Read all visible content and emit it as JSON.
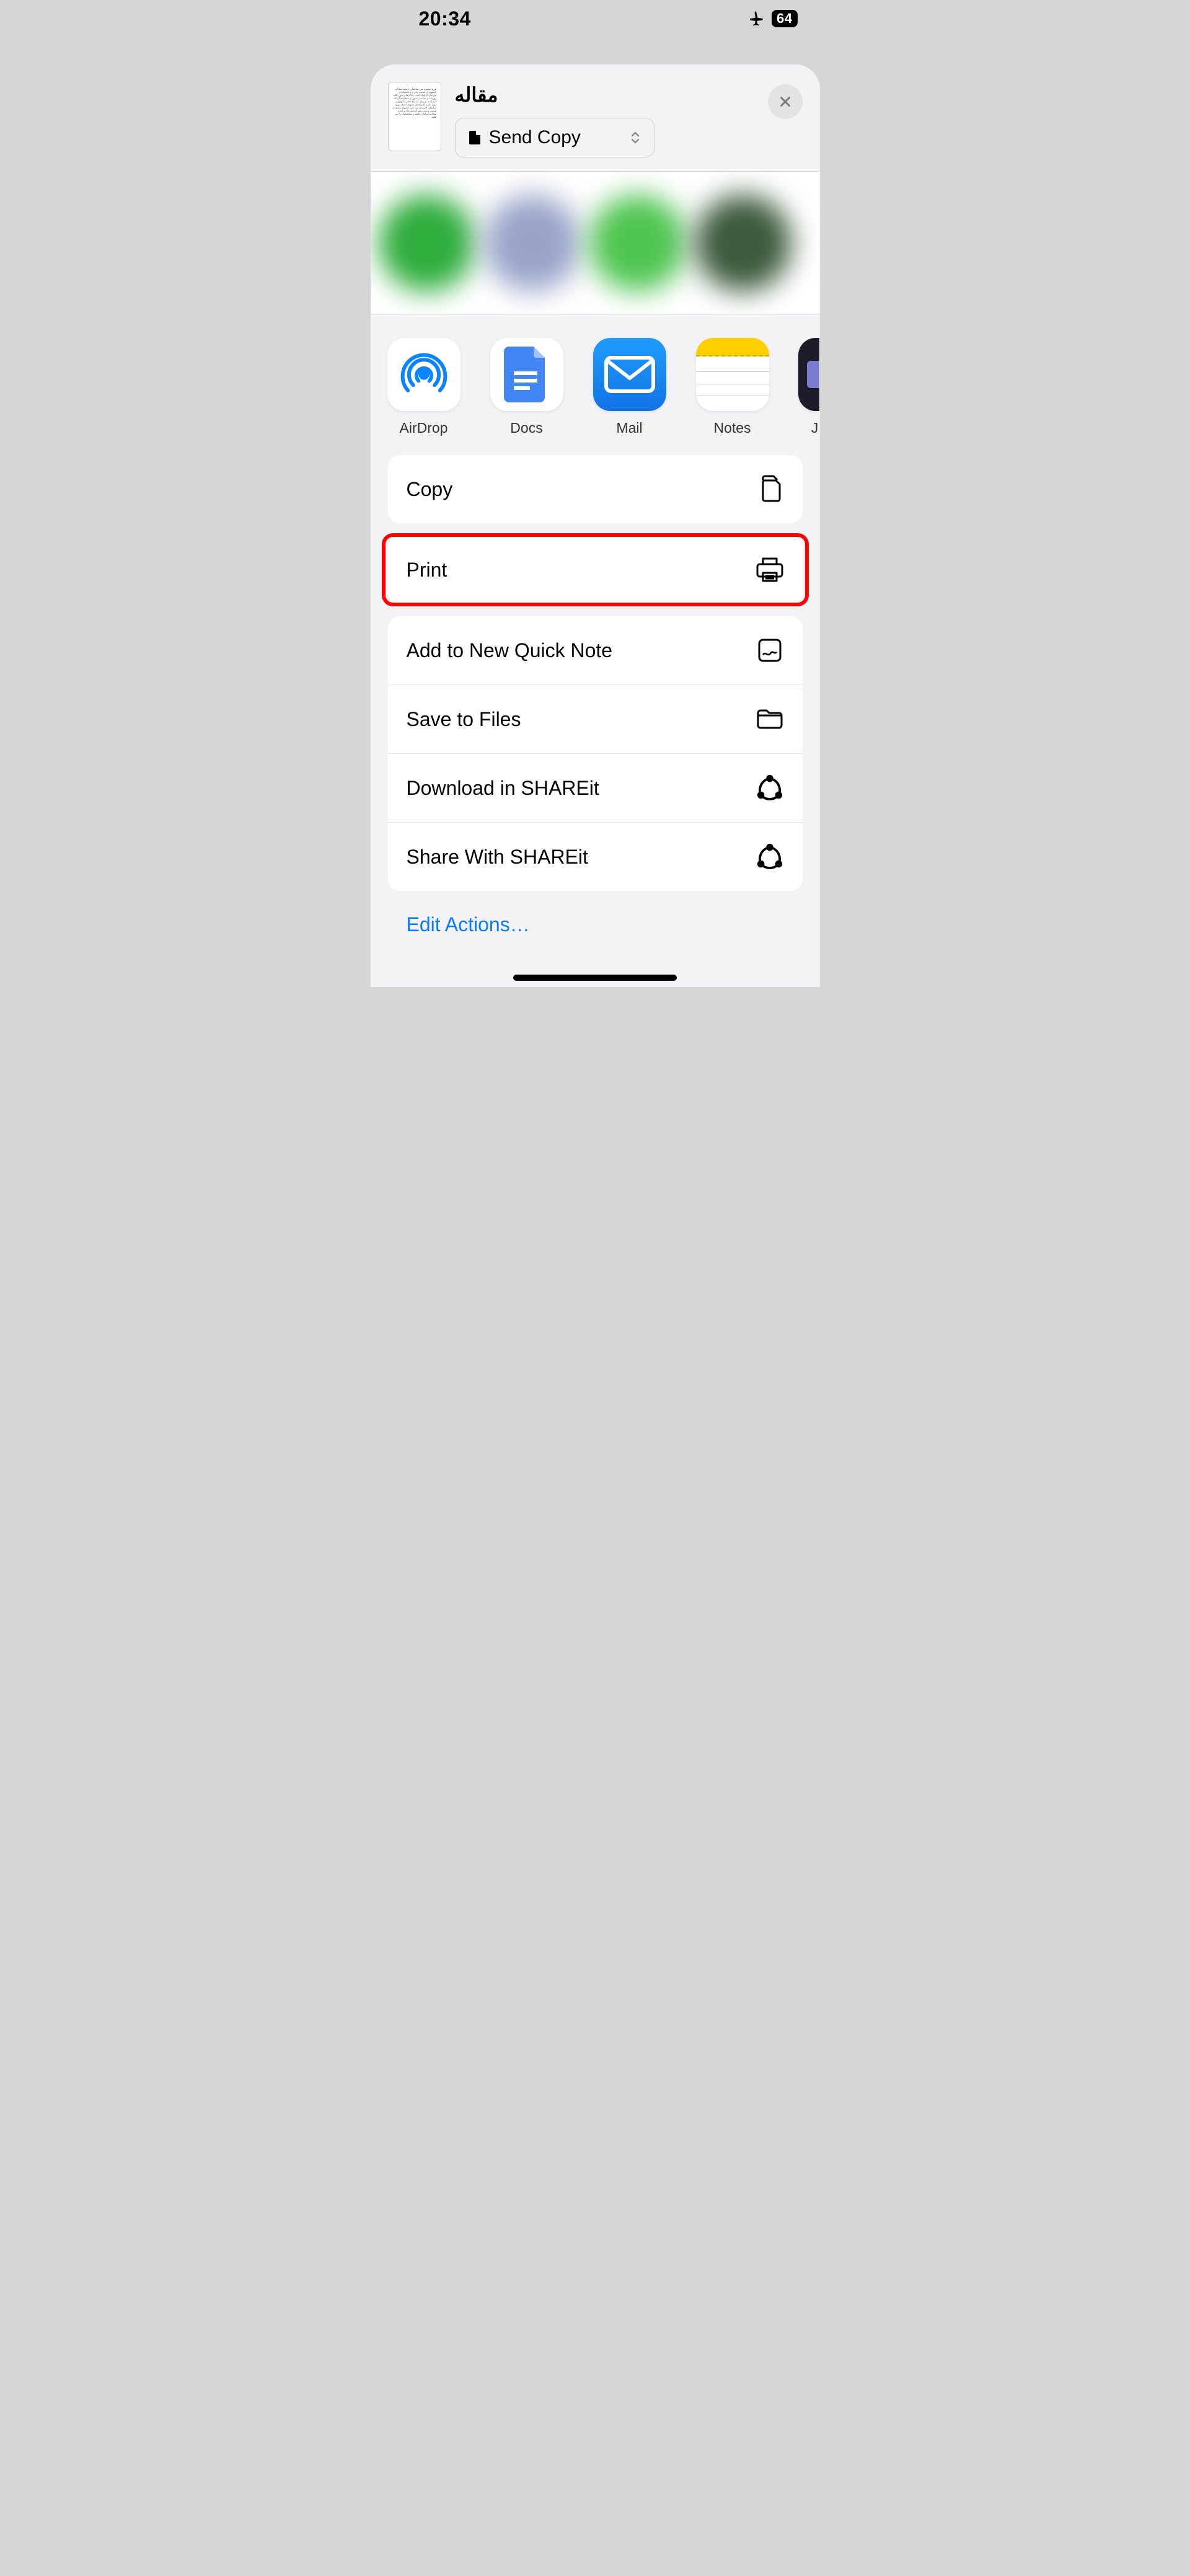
{
  "status": {
    "time": "20:34",
    "battery": "64"
  },
  "header": {
    "title": "مقاله",
    "send_copy": "Send Copy"
  },
  "apps": [
    {
      "label": "AirDrop"
    },
    {
      "label": "Docs"
    },
    {
      "label": "Mail"
    },
    {
      "label": "Notes"
    },
    {
      "label": "J"
    }
  ],
  "actions": {
    "copy": "Copy",
    "print": "Print",
    "quick_note": "Add to New Quick Note",
    "save_files": "Save to Files",
    "download_shareit": "Download in SHAREit",
    "share_shareit": "Share With SHAREit",
    "edit": "Edit Actions…"
  }
}
